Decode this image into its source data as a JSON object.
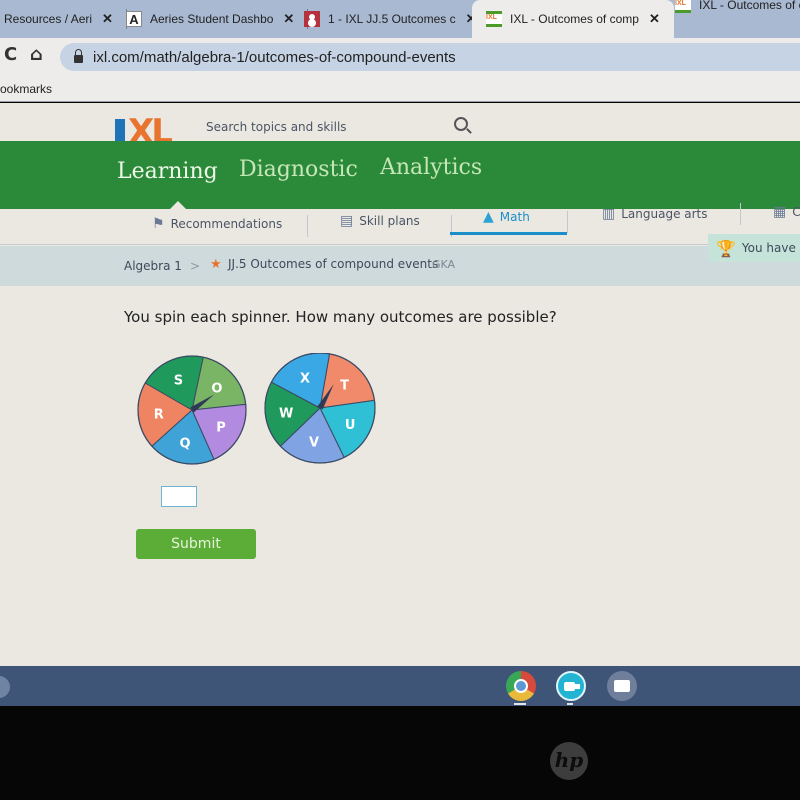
{
  "browser": {
    "tabs": [
      {
        "title": "Resources / Aeri",
        "favicon": "resources-icon"
      },
      {
        "title": "Aeries Student Dashbo",
        "favicon": "aeries-icon"
      },
      {
        "title": "1 - IXL JJ.5 Outcomes c",
        "favicon": "classroom-icon"
      },
      {
        "title": "IXL - Outcomes of comp",
        "favicon": "ixl-icon",
        "active": true
      },
      {
        "title": "IXL - Outcomes of c",
        "favicon": "ixl-icon"
      }
    ],
    "close_glyph": "✕",
    "url": "ixl.com/math/algebra-1/outcomes-of-compound-events",
    "bookmarks_label": "ookmarks"
  },
  "ixl": {
    "logo_i": "I",
    "logo_xl": "XL",
    "search_placeholder": "Search topics and skills",
    "main_tabs": [
      "Learning",
      "Diagnostic",
      "Analytics"
    ],
    "active_main_tab": "Learning",
    "subject_tabs": [
      {
        "label": "Recommendations",
        "icon": "signpost-icon"
      },
      {
        "label": "Skill plans",
        "icon": "skill-plans-icon"
      },
      {
        "label": "Math",
        "icon": "pyramid-icon",
        "active": true
      },
      {
        "label": "Language arts",
        "icon": "book-icon"
      },
      {
        "label": "C",
        "icon": "clipboard-icon"
      }
    ],
    "breadcrumb": {
      "course": "Algebra 1",
      "separator": ">",
      "skill": "JJ.5 Outcomes of compound events",
      "code": "GKA"
    },
    "award_text": "You have",
    "colors": {
      "green_bar": "#2b8a3a",
      "accent_blue": "#1c8ec9",
      "submit_green": "#5cad37",
      "logo_orange": "#e8742f",
      "logo_blue": "#1f73b7"
    }
  },
  "question": {
    "prompt": "You spin each spinner. How many outcomes are possible?",
    "spinners": [
      {
        "name": "spinner-1",
        "sections": [
          {
            "label": "O",
            "color": "#79b564"
          },
          {
            "label": "P",
            "color": "#b28adf"
          },
          {
            "label": "Q",
            "color": "#3fa3d7"
          },
          {
            "label": "R",
            "color": "#ef8463"
          },
          {
            "label": "S",
            "color": "#1f9a5c"
          }
        ]
      },
      {
        "name": "spinner-2",
        "sections": [
          {
            "label": "T",
            "color": "#f08a6a"
          },
          {
            "label": "U",
            "color": "#2fc0d6"
          },
          {
            "label": "V",
            "color": "#7fa3e3"
          },
          {
            "label": "W",
            "color": "#1f9a5c"
          },
          {
            "label": "X",
            "color": "#3aa8e4"
          }
        ]
      }
    ],
    "answer_value": "",
    "submit_label": "Submit"
  },
  "shelf": {
    "apps": [
      "chrome-icon",
      "video-call-icon",
      "camera-icon"
    ]
  },
  "bezel": {
    "brand": "hp"
  }
}
